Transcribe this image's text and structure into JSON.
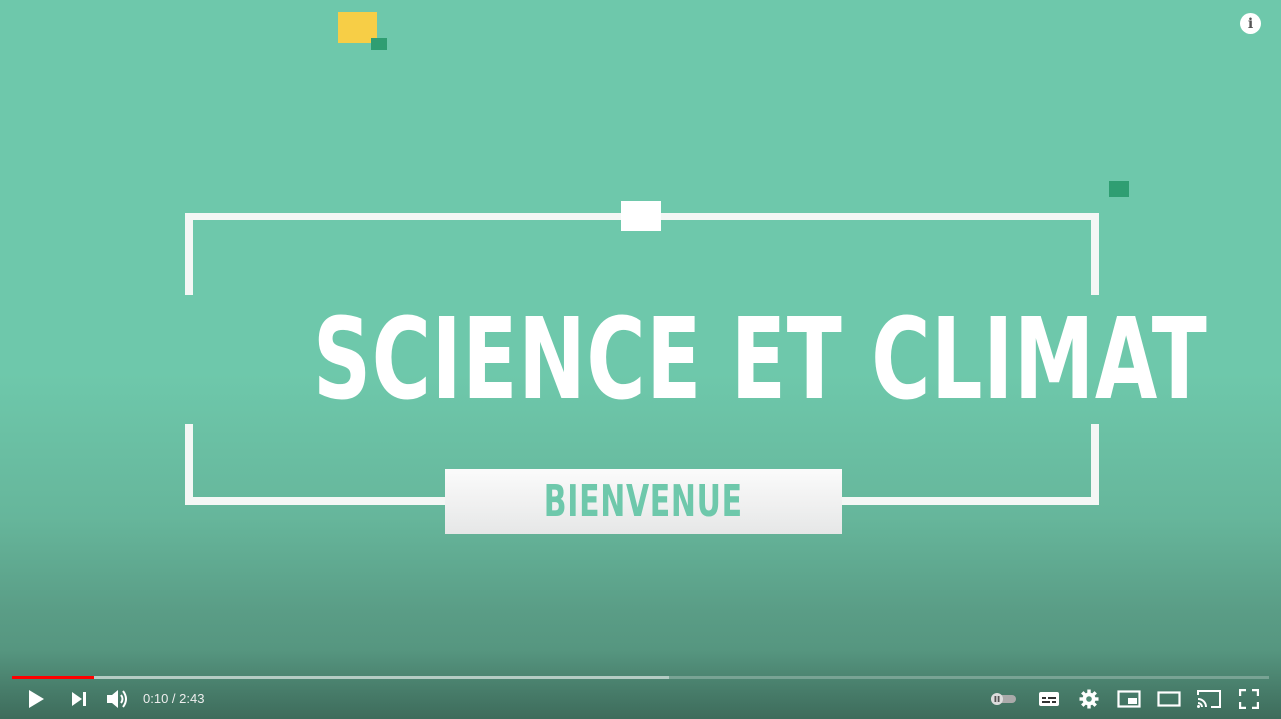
{
  "video": {
    "title_text": "SCIENCE ET CLIMAT",
    "subtitle_text": "BIENVENUE"
  },
  "overlay": {
    "info_icon": "i"
  },
  "player": {
    "current_time": "0:10",
    "duration": "2:43",
    "time_display": "0:10 / 2:43",
    "played_fraction": 0.0654,
    "buffered_fraction": 0.5223,
    "autoplay": "paused",
    "icons": [
      "play-icon",
      "next-icon",
      "volume-icon",
      "autoplay-toggle-icon",
      "subtitles-icon",
      "settings-icon",
      "miniplayer-icon",
      "theater-mode-icon",
      "cast-icon",
      "fullscreen-icon"
    ]
  },
  "colors": {
    "background": "#6ec8ab",
    "accent_yellow": "#f7ce46",
    "accent_green": "#2f9e72",
    "progress_played": "#ff0000"
  }
}
